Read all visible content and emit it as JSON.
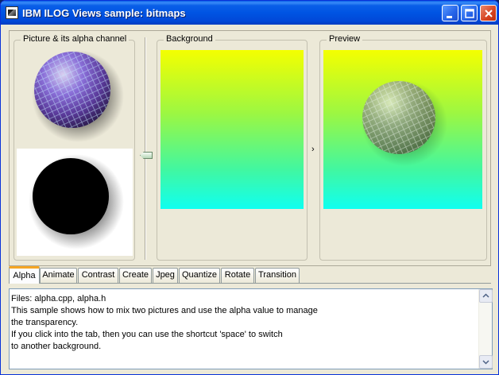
{
  "window": {
    "title": "IBM ILOG Views sample: bitmaps",
    "controls": {
      "minimize": "minimize-icon",
      "maximize": "maximize-icon",
      "close": "close-icon"
    }
  },
  "panels": {
    "source": {
      "title": "Picture & its alpha channel"
    },
    "background": {
      "title": "Background"
    },
    "preview": {
      "title": "Preview"
    },
    "arrow": "›"
  },
  "tabs": [
    {
      "label": "Alpha",
      "active": true
    },
    {
      "label": "Animate",
      "active": false
    },
    {
      "label": "Contrast",
      "active": false
    },
    {
      "label": "Create",
      "active": false
    },
    {
      "label": "Jpeg",
      "active": false
    },
    {
      "label": "Quantize",
      "active": false
    },
    {
      "label": "Rotate",
      "active": false
    },
    {
      "label": "Transition",
      "active": false
    }
  ],
  "description": {
    "lines": [
      "Files: alpha.cpp, alpha.h",
      "This sample shows how to mix two pictures and use the alpha value to manage",
      "the transparency.",
      "If you click into the tab, then you can use the shortcut 'space' to switch",
      "to another background."
    ]
  },
  "colors": {
    "titlebar": "#0054e3",
    "gradient_top": "#f4ff00",
    "gradient_bottom": "#10fff0",
    "active_tab_accent": "#f5a623"
  }
}
